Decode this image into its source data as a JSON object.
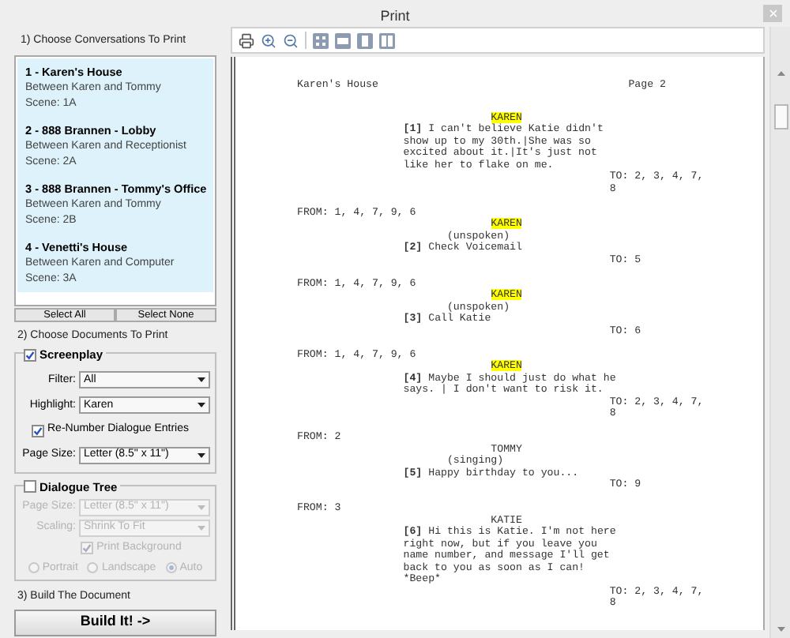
{
  "window": {
    "title": "Print"
  },
  "conversations": {
    "label": "1) Choose Conversations To Print",
    "items": [
      {
        "title": "1 - Karen's House",
        "between": "Between Karen and Tommy",
        "scene": "Scene: 1A",
        "selected": true
      },
      {
        "title": "2 - 888 Brannen - Lobby",
        "between": "Between Karen and Receptionist",
        "scene": "Scene: 2A",
        "selected": true
      },
      {
        "title": "3 - 888 Brannen - Tommy's Office",
        "between": "Between Karen and Tommy",
        "scene": "Scene: 2B",
        "selected": true
      },
      {
        "title": "4 - Venetti's House",
        "between": "Between Karen and Computer",
        "scene": "Scene: 3A",
        "selected": true
      }
    ],
    "select_all": "Select All",
    "select_none": "Select None"
  },
  "documents": {
    "label": "2) Choose Documents To Print",
    "screenplay": {
      "label": "Screenplay",
      "checked": true,
      "filter": {
        "label": "Filter:",
        "value": "All"
      },
      "highlight": {
        "label": "Highlight:",
        "value": "Karen"
      },
      "renumber": {
        "label": "Re-Number Dialogue Entries",
        "checked": true
      },
      "page_size": {
        "label": "Page Size:",
        "value": "Letter (8.5\" x 11\")"
      }
    },
    "dialogue_tree": {
      "label": "Dialogue Tree",
      "checked": false,
      "page_size": {
        "label": "Page Size:",
        "value": "Letter (8.5\" x 11\")"
      },
      "scaling": {
        "label": "Scaling:",
        "value": "Shrink To Fit"
      },
      "print_background": {
        "label": "Print Background",
        "checked": true
      },
      "orientation": [
        {
          "label": "Portrait",
          "selected": false
        },
        {
          "label": "Landscape",
          "selected": false
        },
        {
          "label": "Auto",
          "selected": true
        }
      ]
    }
  },
  "build": {
    "label": "3) Build The Document",
    "button": "Build It! ->"
  },
  "preview": {
    "header_left": "Karen's House",
    "header_right": "Page 2",
    "entries": [
      {
        "speaker": "KAREN",
        "highlighted": true,
        "number": "[1]",
        "lines": [
          "I can't believe Katie didn't",
          "show up to my 30th.|She was so",
          "excited about it.|It's just not",
          "like her to flake on me."
        ],
        "to": [
          "TO: 2, 3, 4, 7,",
          "8"
        ]
      },
      {
        "from": "FROM: 1, 4, 7, 9, 6",
        "speaker": "KAREN",
        "highlighted": true,
        "parenthetical": "(unspoken)",
        "number": "[2]",
        "lines": [
          "Check Voicemail"
        ],
        "to": [
          "TO: 5"
        ]
      },
      {
        "from": "FROM: 1, 4, 7, 9, 6",
        "speaker": "KAREN",
        "highlighted": true,
        "parenthetical": "(unspoken)",
        "number": "[3]",
        "lines": [
          "Call Katie"
        ],
        "to": [
          "TO: 6"
        ]
      },
      {
        "from": "FROM: 1, 4, 7, 9, 6",
        "speaker": "KAREN",
        "highlighted": true,
        "number": "[4]",
        "lines": [
          "Maybe I should just do what he",
          "says. | I don't want to risk it."
        ],
        "to": [
          "TO: 2, 3, 4, 7,",
          "8"
        ]
      },
      {
        "from": "FROM: 2",
        "speaker": "TOMMY",
        "highlighted": false,
        "parenthetical": "(singing)",
        "number": "[5]",
        "lines": [
          "Happy birthday to you..."
        ],
        "to": [
          "TO: 9"
        ]
      },
      {
        "from": "FROM: 3",
        "speaker": "KATIE",
        "highlighted": false,
        "number": "[6]",
        "lines": [
          "Hi this is Katie. I'm not here",
          "right now, but if you leave you",
          "name number, and message I'll get",
          "back to you as soon as I can!",
          "*Beep*"
        ],
        "to": [
          "TO: 2, 3, 4, 7,",
          "8"
        ]
      }
    ]
  }
}
